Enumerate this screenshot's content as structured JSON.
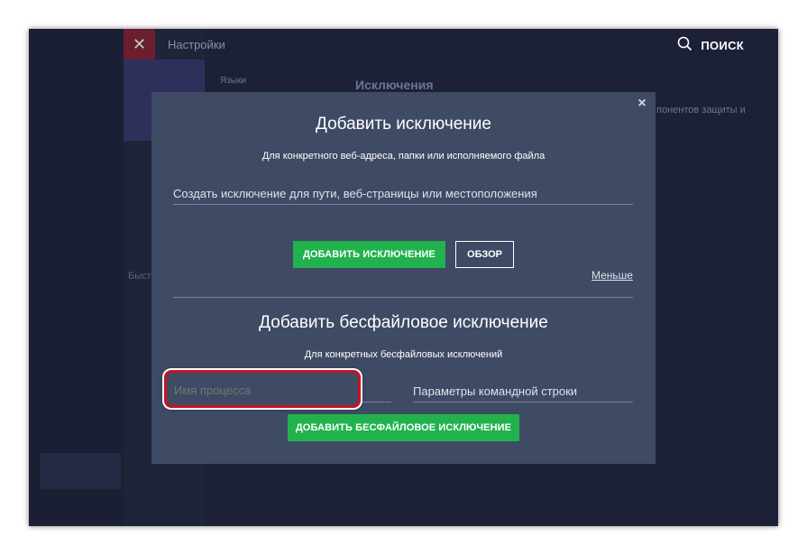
{
  "app": {
    "title": "Настройки",
    "close_glyph": "✕",
    "search_label": "ПОИСК",
    "search_icon": "search-icon",
    "bg_nav_item": "Языки",
    "bg_section_title": "Исключения",
    "bg_side_text": "понентов защиты и",
    "bg_fast": "Быстр"
  },
  "dialog": {
    "close_glyph": "×",
    "title": "Добавить исключение",
    "subtitle": "Для конкретного веб-адреса, папки или исполняемого файла",
    "path_placeholder": "Создать исключение для пути, веб-страницы или местоположения",
    "add_button": "ДОБАВИТЬ ИСКЛЮЧЕНИЕ",
    "browse_button": "ОБЗОР",
    "less_link": "Меньше",
    "fileless_title": "Добавить бесфайловое исключение",
    "fileless_subtitle": "Для конкретных бесфайловых исключений",
    "process_placeholder": "Имя процесса",
    "cmdline_placeholder": "Параметры командной строки",
    "add_fileless_button": "ДОБАВИТЬ БЕСФАЙЛОВОЕ ИСКЛЮЧЕНИЕ"
  },
  "colors": {
    "accent_green": "#21b24e",
    "dialog_bg": "#3f4a65",
    "app_bg": "#1c2138",
    "highlight_red": "#c8141e"
  }
}
